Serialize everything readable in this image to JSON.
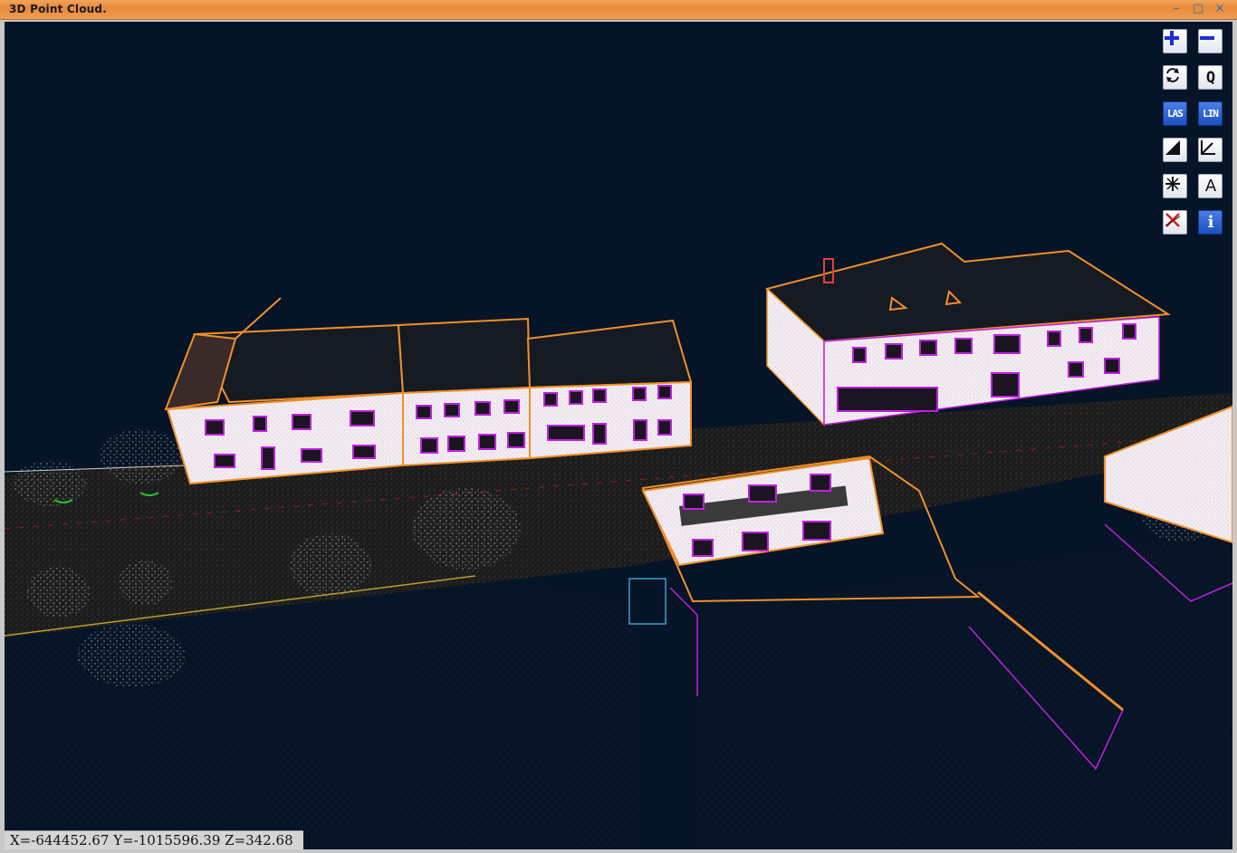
{
  "window": {
    "title": "3D Point Cloud.",
    "minimize_glyph": "–",
    "maximize_glyph": "□",
    "close_glyph": "×"
  },
  "toolbar": {
    "buttons": [
      {
        "name": "zoom-in-button",
        "icon": "plus-icon",
        "label": ""
      },
      {
        "name": "zoom-out-button",
        "icon": "minus-icon",
        "label": ""
      },
      {
        "name": "rotate-button",
        "icon": "rotate-icon",
        "label": ""
      },
      {
        "name": "query-button",
        "icon": "query-icon",
        "label": "Q"
      },
      {
        "name": "las-button",
        "icon": "las-icon",
        "label": "LAS"
      },
      {
        "name": "lin-button",
        "icon": "lin-icon",
        "label": "LIN"
      },
      {
        "name": "shading-button",
        "icon": "contrast-icon",
        "label": ""
      },
      {
        "name": "axis-button",
        "icon": "axis-icon",
        "label": ""
      },
      {
        "name": "snap-button",
        "icon": "snap-icon",
        "label": ""
      },
      {
        "name": "annotate-button",
        "icon": "text-icon",
        "label": "A"
      },
      {
        "name": "delete-button",
        "icon": "delete-icon",
        "label": ""
      },
      {
        "name": "info-button",
        "icon": "info-icon",
        "label": "i"
      }
    ]
  },
  "status": {
    "coordinates": "X=-644452.67 Y=-1015596.39 Z=342.68"
  },
  "colors": {
    "background": "#051426",
    "roof_outline": "#f0902a",
    "window_outline": "#c020e0",
    "road": "#3a3a3a",
    "facade": "#f4eef4"
  }
}
